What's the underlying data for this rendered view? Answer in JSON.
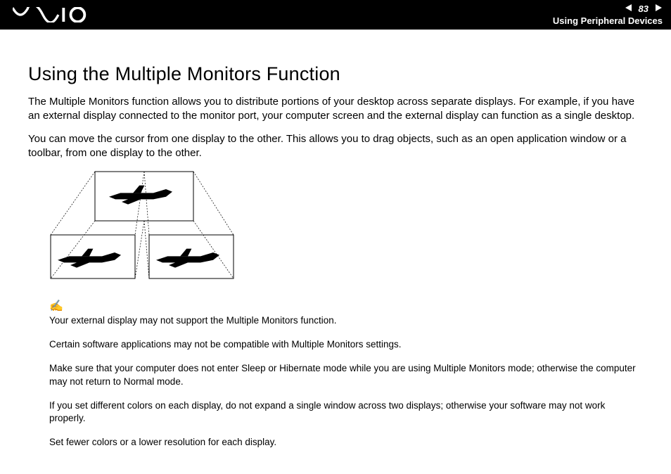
{
  "header": {
    "logo_alt": "VAIO",
    "page_number": "83",
    "section": "Using Peripheral Devices"
  },
  "content": {
    "title": "Using the Multiple Monitors Function",
    "para1": "The Multiple Monitors function allows you to distribute portions of your desktop across separate displays. For example, if you have an external display connected to the monitor port, your computer screen and the external display can function as a single desktop.",
    "para2": "You can move the cursor from one display to the other. This allows you to drag objects, such as an open application window or a toolbar, from one display to the other."
  },
  "notes": {
    "n1": "Your external display may not support the Multiple Monitors function.",
    "n2": "Certain software applications may not be compatible with Multiple Monitors settings.",
    "n3": "Make sure that your computer does not enter Sleep or Hibernate mode while you are using Multiple Monitors mode; otherwise the computer may not return to Normal mode.",
    "n4": "If you set different colors on each display, do not expand a single window across two displays; otherwise your software may not work properly.",
    "n5": "Set fewer colors or a lower resolution for each display."
  }
}
